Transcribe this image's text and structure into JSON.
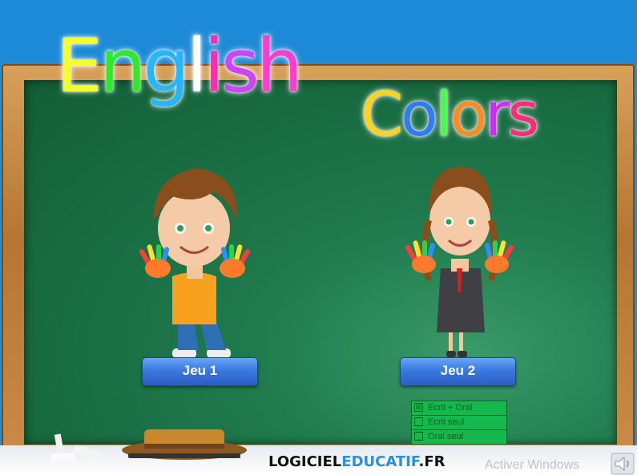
{
  "title": {
    "word1": [
      "E",
      "n",
      "g",
      "l",
      "i",
      "s",
      "h"
    ],
    "word1_colors": [
      "#f4ff2a",
      "#2eea2a",
      "#26b6ff",
      "#ffffff",
      "#ff2bb5",
      "#cc44ff",
      "#ff3bd0"
    ],
    "word2": [
      "C",
      "o",
      "l",
      "o",
      "r",
      "s"
    ],
    "word2_colors": [
      "#ffd21e",
      "#2f7bff",
      "#44ff44",
      "#ff8a1f",
      "#cc2bff",
      "#ff2b7a"
    ]
  },
  "buttons": {
    "game1": "Jeu 1",
    "game2": "Jeu 2"
  },
  "modes": [
    {
      "label": "Ecrit + Oral",
      "checked": true,
      "mark": "☒"
    },
    {
      "label": "Ecrit seul",
      "checked": false,
      "mark": ""
    },
    {
      "label": "Oral seul",
      "checked": false,
      "mark": ""
    }
  ],
  "logo": {
    "part1": "LOGICIEL",
    "part2": "EDUCATIF",
    "part3": ".FR"
  },
  "watermark": "Activer Windows",
  "icons": {
    "sound": "speaker-icon"
  }
}
